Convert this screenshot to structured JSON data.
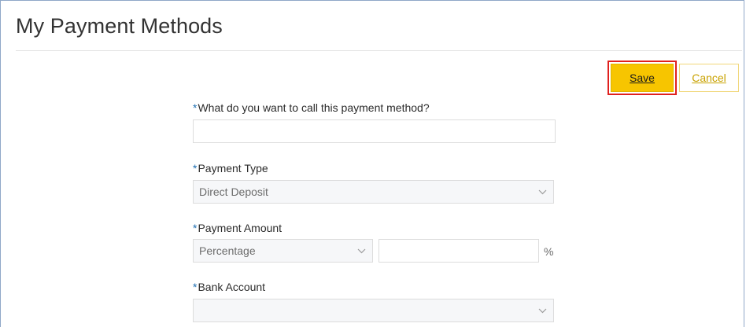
{
  "page": {
    "title": "My Payment Methods"
  },
  "actions": {
    "save_label": "Save",
    "cancel_label": "Cancel"
  },
  "form": {
    "name_field": {
      "required_mark": "*",
      "label": "What do you want to call this payment method?",
      "value": ""
    },
    "payment_type": {
      "required_mark": "*",
      "label": "Payment Type",
      "selected": "Direct Deposit"
    },
    "payment_amount": {
      "required_mark": "*",
      "label": "Payment Amount",
      "amount_type_selected": "Percentage",
      "amount_value": "",
      "unit": "%"
    },
    "bank_account": {
      "required_mark": "*",
      "label": "Bank Account",
      "selected": ""
    }
  },
  "icons": {
    "dropdown": "chevron-down-icon"
  },
  "colors": {
    "primary_button": "#f7c500",
    "highlight_border": "#e0201e",
    "required_asterisk": "#1f6fb2",
    "cancel_text": "#c9a200"
  }
}
